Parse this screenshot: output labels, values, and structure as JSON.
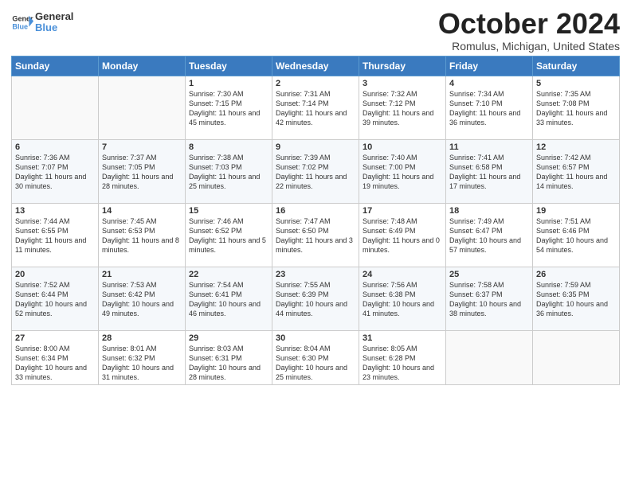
{
  "header": {
    "logo_line1": "General",
    "logo_line2": "Blue",
    "month": "October 2024",
    "location": "Romulus, Michigan, United States"
  },
  "weekdays": [
    "Sunday",
    "Monday",
    "Tuesday",
    "Wednesday",
    "Thursday",
    "Friday",
    "Saturday"
  ],
  "weeks": [
    [
      {
        "day": "",
        "info": ""
      },
      {
        "day": "",
        "info": ""
      },
      {
        "day": "1",
        "info": "Sunrise: 7:30 AM\nSunset: 7:15 PM\nDaylight: 11 hours and 45 minutes."
      },
      {
        "day": "2",
        "info": "Sunrise: 7:31 AM\nSunset: 7:14 PM\nDaylight: 11 hours and 42 minutes."
      },
      {
        "day": "3",
        "info": "Sunrise: 7:32 AM\nSunset: 7:12 PM\nDaylight: 11 hours and 39 minutes."
      },
      {
        "day": "4",
        "info": "Sunrise: 7:34 AM\nSunset: 7:10 PM\nDaylight: 11 hours and 36 minutes."
      },
      {
        "day": "5",
        "info": "Sunrise: 7:35 AM\nSunset: 7:08 PM\nDaylight: 11 hours and 33 minutes."
      }
    ],
    [
      {
        "day": "6",
        "info": "Sunrise: 7:36 AM\nSunset: 7:07 PM\nDaylight: 11 hours and 30 minutes."
      },
      {
        "day": "7",
        "info": "Sunrise: 7:37 AM\nSunset: 7:05 PM\nDaylight: 11 hours and 28 minutes."
      },
      {
        "day": "8",
        "info": "Sunrise: 7:38 AM\nSunset: 7:03 PM\nDaylight: 11 hours and 25 minutes."
      },
      {
        "day": "9",
        "info": "Sunrise: 7:39 AM\nSunset: 7:02 PM\nDaylight: 11 hours and 22 minutes."
      },
      {
        "day": "10",
        "info": "Sunrise: 7:40 AM\nSunset: 7:00 PM\nDaylight: 11 hours and 19 minutes."
      },
      {
        "day": "11",
        "info": "Sunrise: 7:41 AM\nSunset: 6:58 PM\nDaylight: 11 hours and 17 minutes."
      },
      {
        "day": "12",
        "info": "Sunrise: 7:42 AM\nSunset: 6:57 PM\nDaylight: 11 hours and 14 minutes."
      }
    ],
    [
      {
        "day": "13",
        "info": "Sunrise: 7:44 AM\nSunset: 6:55 PM\nDaylight: 11 hours and 11 minutes."
      },
      {
        "day": "14",
        "info": "Sunrise: 7:45 AM\nSunset: 6:53 PM\nDaylight: 11 hours and 8 minutes."
      },
      {
        "day": "15",
        "info": "Sunrise: 7:46 AM\nSunset: 6:52 PM\nDaylight: 11 hours and 5 minutes."
      },
      {
        "day": "16",
        "info": "Sunrise: 7:47 AM\nSunset: 6:50 PM\nDaylight: 11 hours and 3 minutes."
      },
      {
        "day": "17",
        "info": "Sunrise: 7:48 AM\nSunset: 6:49 PM\nDaylight: 11 hours and 0 minutes."
      },
      {
        "day": "18",
        "info": "Sunrise: 7:49 AM\nSunset: 6:47 PM\nDaylight: 10 hours and 57 minutes."
      },
      {
        "day": "19",
        "info": "Sunrise: 7:51 AM\nSunset: 6:46 PM\nDaylight: 10 hours and 54 minutes."
      }
    ],
    [
      {
        "day": "20",
        "info": "Sunrise: 7:52 AM\nSunset: 6:44 PM\nDaylight: 10 hours and 52 minutes."
      },
      {
        "day": "21",
        "info": "Sunrise: 7:53 AM\nSunset: 6:42 PM\nDaylight: 10 hours and 49 minutes."
      },
      {
        "day": "22",
        "info": "Sunrise: 7:54 AM\nSunset: 6:41 PM\nDaylight: 10 hours and 46 minutes."
      },
      {
        "day": "23",
        "info": "Sunrise: 7:55 AM\nSunset: 6:39 PM\nDaylight: 10 hours and 44 minutes."
      },
      {
        "day": "24",
        "info": "Sunrise: 7:56 AM\nSunset: 6:38 PM\nDaylight: 10 hours and 41 minutes."
      },
      {
        "day": "25",
        "info": "Sunrise: 7:58 AM\nSunset: 6:37 PM\nDaylight: 10 hours and 38 minutes."
      },
      {
        "day": "26",
        "info": "Sunrise: 7:59 AM\nSunset: 6:35 PM\nDaylight: 10 hours and 36 minutes."
      }
    ],
    [
      {
        "day": "27",
        "info": "Sunrise: 8:00 AM\nSunset: 6:34 PM\nDaylight: 10 hours and 33 minutes."
      },
      {
        "day": "28",
        "info": "Sunrise: 8:01 AM\nSunset: 6:32 PM\nDaylight: 10 hours and 31 minutes."
      },
      {
        "day": "29",
        "info": "Sunrise: 8:03 AM\nSunset: 6:31 PM\nDaylight: 10 hours and 28 minutes."
      },
      {
        "day": "30",
        "info": "Sunrise: 8:04 AM\nSunset: 6:30 PM\nDaylight: 10 hours and 25 minutes."
      },
      {
        "day": "31",
        "info": "Sunrise: 8:05 AM\nSunset: 6:28 PM\nDaylight: 10 hours and 23 minutes."
      },
      {
        "day": "",
        "info": ""
      },
      {
        "day": "",
        "info": ""
      }
    ]
  ]
}
